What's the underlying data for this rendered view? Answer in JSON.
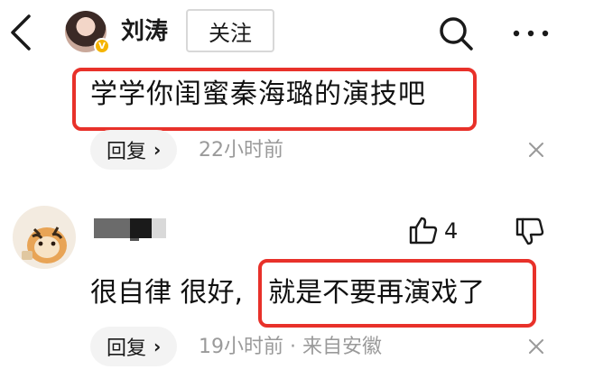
{
  "header": {
    "username": "刘涛",
    "follow_label": "关注",
    "verified_mark": "V"
  },
  "comment_main": {
    "text": "学学你闺蜜秦海璐的演技吧",
    "reply_label": "回复",
    "reply_chevron": "›",
    "time": "22小时前"
  },
  "comment_reply": {
    "like_count": "4",
    "text_part_a": "很自律 很好,",
    "text_part_b": "就是不要再演戏了",
    "reply_label": "回复",
    "reply_chevron": "›",
    "time_location": "19小时前 · 来自安徽"
  },
  "icons": {
    "back": "back-arrow-icon",
    "search": "search-icon",
    "more": "more-icon",
    "close": "close-icon",
    "like": "thumbs-up-icon",
    "dislike": "thumbs-down-icon"
  },
  "colors": {
    "highlight": "#e8312a",
    "verified": "#f5b400",
    "meta_text": "#9a9a9a",
    "reply_bg": "#f3f3f3"
  }
}
